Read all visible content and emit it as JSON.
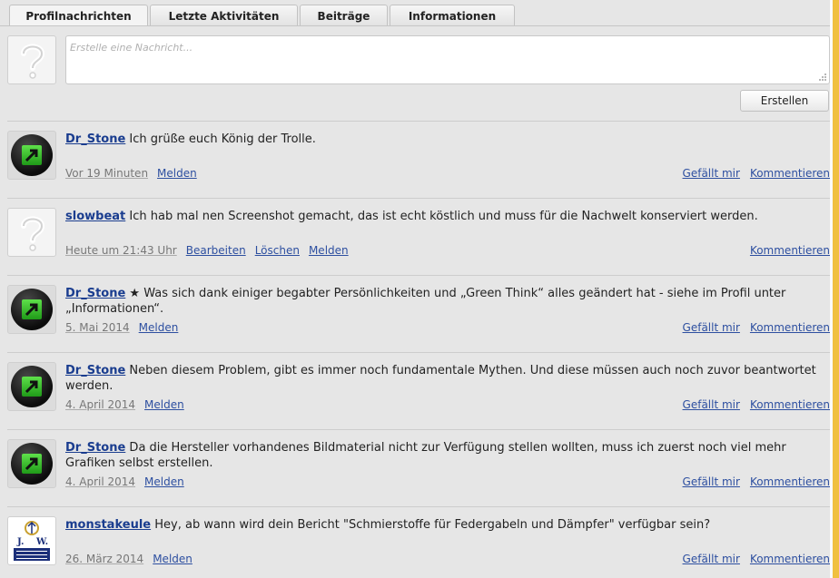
{
  "tabs": [
    "Profilnachrichten",
    "Letzte Aktivitäten",
    "Beiträge",
    "Informationen"
  ],
  "compose": {
    "placeholder": "Erstelle eine Nachricht...",
    "submit_label": "Erstellen"
  },
  "messages": [
    {
      "author": "Dr_Stone",
      "avatar": "green-arrow-icon",
      "text": " Ich grüße euch König der Trolle.",
      "time": "Vor 19 Minuten",
      "meta_links": [
        "Melden"
      ],
      "actions": [
        "Gefällt mir",
        "Kommentieren"
      ]
    },
    {
      "author": "slowbeat",
      "avatar": "question-mark-placeholder",
      "text": " Ich hab mal nen Screenshot gemacht, das ist echt köstlich und muss für die Nachwelt konserviert werden.",
      "time": "Heute um 21:43 Uhr",
      "meta_links": [
        "Bearbeiten",
        "Löschen",
        "Melden"
      ],
      "actions": [
        "Kommentieren"
      ]
    },
    {
      "author": "Dr_Stone",
      "avatar": "green-arrow-icon",
      "text": " ★ Was sich dank einiger begabter Persönlichkeiten und „Green Think“ alles geändert hat - siehe im Profil unter „Informationen“.",
      "time": "5. Mai 2014",
      "meta_links": [
        "Melden"
      ],
      "actions": [
        "Gefällt mir",
        "Kommentieren"
      ]
    },
    {
      "author": "Dr_Stone",
      "avatar": "green-arrow-icon",
      "text": " Neben diesem Problem, gibt es immer noch fundamentale Mythen. Und diese müssen auch noch zuvor beantwortet werden.",
      "time": "4. April 2014",
      "meta_links": [
        "Melden"
      ],
      "actions": [
        "Gefällt mir",
        "Kommentieren"
      ]
    },
    {
      "author": "Dr_Stone",
      "avatar": "green-arrow-icon",
      "text": " Da die Hersteller vorhandenes Bildmaterial nicht zur Verfügung stellen wollten, muss ich zuerst noch viel mehr Grafiken selbst erstellen.",
      "time": "4. April 2014",
      "meta_links": [
        "Melden"
      ],
      "actions": [
        "Gefällt mir",
        "Kommentieren"
      ]
    },
    {
      "author": "monstakeule",
      "avatar": "augustiner-logo",
      "text": " Hey, ab wann wird dein Bericht \"Schmierstoffe für Federgabeln und Dämpfer\" verfügbar sein?",
      "time": "26. März 2014",
      "meta_links": [
        "Melden"
      ],
      "actions": [
        "Gefällt mir",
        "Kommentieren"
      ]
    }
  ],
  "logo_text": "J.W. Augustiner-Bräu München"
}
